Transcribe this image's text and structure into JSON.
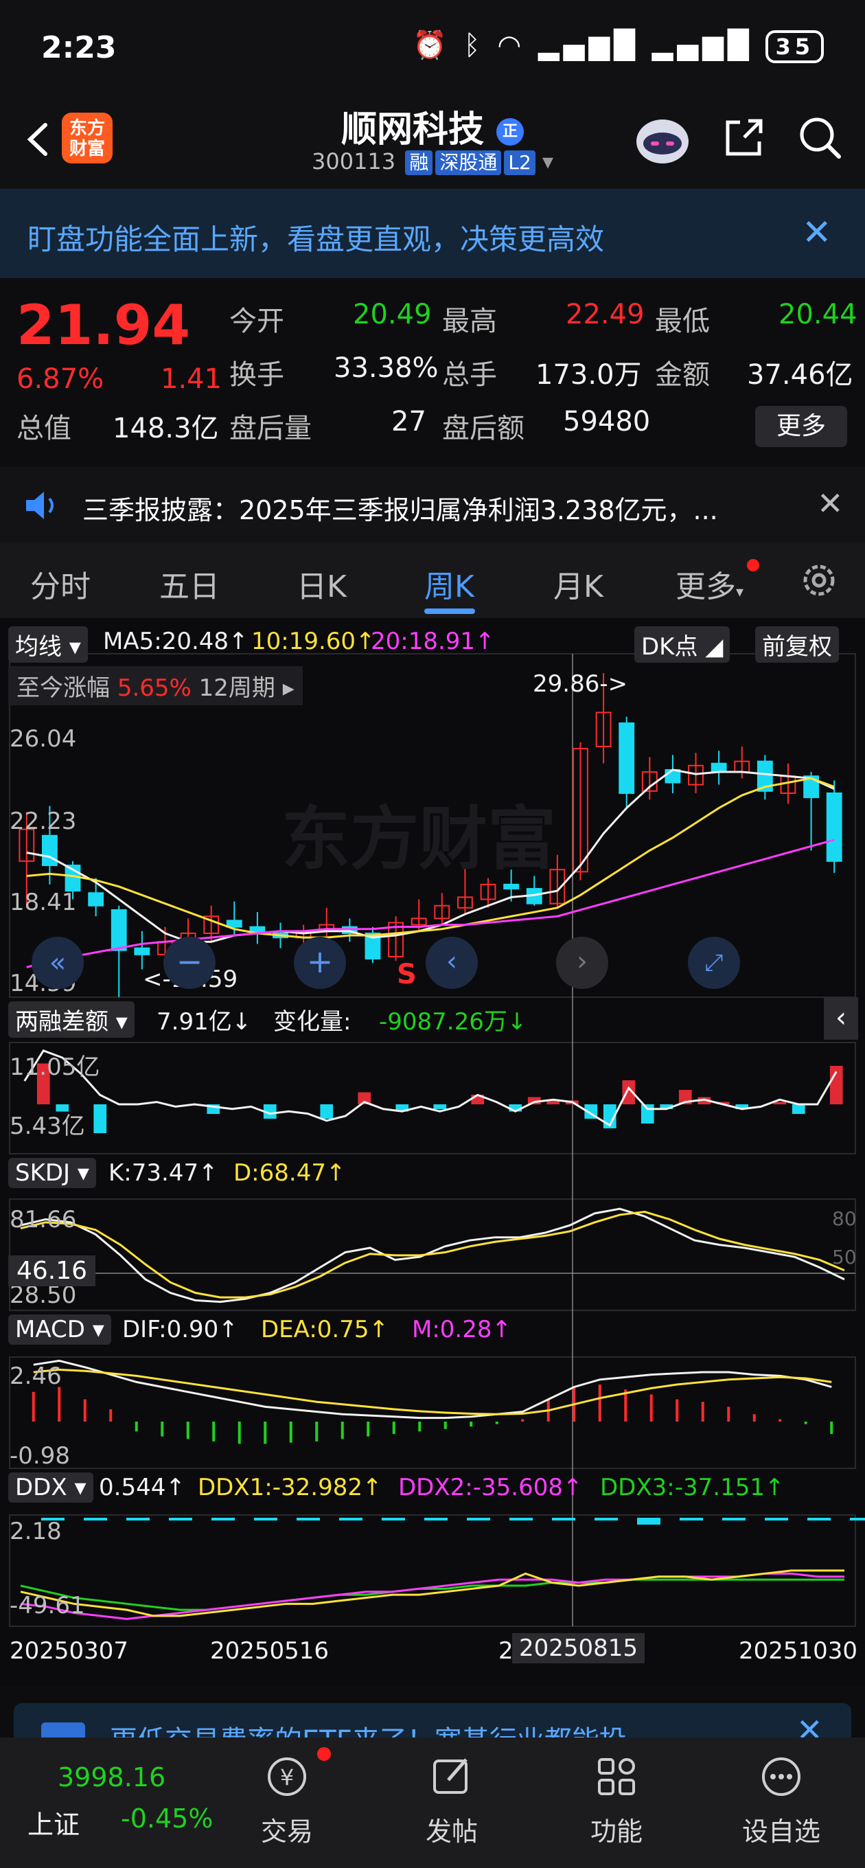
{
  "status": {
    "time": "2:23",
    "battery": "35"
  },
  "header": {
    "logo": "东方财富",
    "name": "顺网科技",
    "code": "300113",
    "tags": [
      "融",
      "深股通",
      "L2"
    ]
  },
  "banner": {
    "text": "盯盘功能全面上新，看盘更直观，决策更高效"
  },
  "quote": {
    "price": "21.94",
    "pct": "6.87%",
    "change": "1.41",
    "open_label": "今开",
    "open": "20.49",
    "high_label": "最高",
    "high": "22.49",
    "low_label": "最低",
    "low": "20.44",
    "turnover_label": "换手",
    "turnover": "33.38%",
    "volume_label": "总手",
    "volume": "173.0万",
    "amount_label": "金额",
    "amount": "37.46亿",
    "mcap_label": "总值",
    "mcap": "148.3亿",
    "after_vol_label": "盘后量",
    "after_vol": "27",
    "after_amt_label": "盘后额",
    "after_amt": "59480",
    "more": "更多"
  },
  "news": {
    "text": "三季报披露：2025年三季报归属净利润3.238亿元，..."
  },
  "tabs": [
    "分时",
    "五日",
    "日K",
    "周K",
    "月K",
    "更多"
  ],
  "indicators": {
    "ma_select": "均线",
    "ma5": "MA5:20.48↑",
    "ma10": "10:19.60↑",
    "ma20": "20:18.91↑",
    "dk": "DK点",
    "fq": "前复权",
    "range_label": "至今涨幅",
    "range_pct": "5.65%",
    "range_period": "12周期",
    "peak_label": "29.86->",
    "trough_label": "<-14.59",
    "s_mark": "S",
    "rz_select": "两融差额",
    "rz_value": "7.91亿↓",
    "rz_change_label": "变化量:",
    "rz_change": "-9087.26万↓",
    "skdj_select": "SKDJ",
    "skdj_k": "K:73.47↑",
    "skdj_d": "D:68.47↑",
    "skdj_cursor": "46.16",
    "macd_select": "MACD",
    "macd_dif": "DIF:0.90↑",
    "macd_dea": "DEA:0.75↑",
    "macd_m": "M:0.28↑",
    "ddx_select": "DDX",
    "ddx": "0.544↑",
    "ddx1": "DDX1:-32.982↑",
    "ddx2": "DDX2:-35.608↑",
    "ddx3": "DDX3:-37.151↑"
  },
  "axes": {
    "k_ticks": [
      "26.04",
      "22.23",
      "18.41",
      "14.59"
    ],
    "rz_ticks": [
      "11.05亿",
      "5.43亿"
    ],
    "skdj_ticks": [
      "81.66",
      "28.50"
    ],
    "skdj_right": [
      "80",
      "50"
    ],
    "macd_ticks": [
      "2.46",
      "-0.98"
    ],
    "ddx_ticks": [
      "2.18",
      "-49.61"
    ],
    "dates": [
      "20250307",
      "20250516",
      "2",
      "20250815",
      "20251030"
    ]
  },
  "ad": {
    "text": "更低交易费率的ETF来了！宽基行业都能投"
  },
  "nav": {
    "index_name": "上证",
    "index_value": "3998.16",
    "index_pct": "-0.45%",
    "items": [
      "交易",
      "发帖",
      "功能",
      "设自选"
    ]
  },
  "chart_data": {
    "type": "candlestick",
    "candles": [
      {
        "o": 21.0,
        "c": 22.5,
        "h": 23.3,
        "l": 18.8
      },
      {
        "o": 22.2,
        "c": 20.8,
        "h": 23.6,
        "l": 19.9
      },
      {
        "o": 20.8,
        "c": 19.6,
        "h": 21.0,
        "l": 19.2
      },
      {
        "o": 19.5,
        "c": 18.9,
        "h": 20.2,
        "l": 18.4
      },
      {
        "o": 18.7,
        "c": 16.8,
        "h": 18.9,
        "l": 14.6
      },
      {
        "o": 16.9,
        "c": 16.6,
        "h": 17.7,
        "l": 15.9
      },
      {
        "o": 16.6,
        "c": 17.2,
        "h": 17.9,
        "l": 16.1
      },
      {
        "o": 17.1,
        "c": 17.6,
        "h": 18.3,
        "l": 16.7
      },
      {
        "o": 17.6,
        "c": 18.4,
        "h": 18.9,
        "l": 17.2
      },
      {
        "o": 18.2,
        "c": 17.9,
        "h": 19.1,
        "l": 17.5
      },
      {
        "o": 17.9,
        "c": 17.6,
        "h": 18.6,
        "l": 17.1
      },
      {
        "o": 17.6,
        "c": 17.4,
        "h": 18.1,
        "l": 16.9
      },
      {
        "o": 17.4,
        "c": 17.7,
        "h": 18.0,
        "l": 17.0
      },
      {
        "o": 17.7,
        "c": 18.0,
        "h": 18.8,
        "l": 17.3
      },
      {
        "o": 17.9,
        "c": 17.6,
        "h": 18.3,
        "l": 17.2
      },
      {
        "o": 17.6,
        "c": 16.4,
        "h": 17.9,
        "l": 16.2
      },
      {
        "o": 16.5,
        "c": 18.1,
        "h": 18.4,
        "l": 16.3
      },
      {
        "o": 18.0,
        "c": 18.3,
        "h": 19.2,
        "l": 17.7
      },
      {
        "o": 18.3,
        "c": 18.9,
        "h": 19.5,
        "l": 18.0
      },
      {
        "o": 18.8,
        "c": 19.3,
        "h": 20.7,
        "l": 18.5
      },
      {
        "o": 19.2,
        "c": 19.9,
        "h": 20.2,
        "l": 18.8
      },
      {
        "o": 19.9,
        "c": 19.7,
        "h": 20.6,
        "l": 19.1
      },
      {
        "o": 19.7,
        "c": 19.0,
        "h": 20.3,
        "l": 18.9
      },
      {
        "o": 19.0,
        "c": 20.6,
        "h": 21.3,
        "l": 18.8
      },
      {
        "o": 20.5,
        "c": 26.3,
        "h": 26.6,
        "l": 20.1
      },
      {
        "o": 26.4,
        "c": 28.0,
        "h": 29.86,
        "l": 25.6
      },
      {
        "o": 27.5,
        "c": 24.2,
        "h": 27.8,
        "l": 23.5
      },
      {
        "o": 24.3,
        "c": 25.2,
        "h": 25.9,
        "l": 23.9
      },
      {
        "o": 25.3,
        "c": 24.7,
        "h": 26.0,
        "l": 24.2
      },
      {
        "o": 24.6,
        "c": 25.5,
        "h": 26.1,
        "l": 24.2
      },
      {
        "o": 25.6,
        "c": 25.2,
        "h": 26.2,
        "l": 24.6
      },
      {
        "o": 25.2,
        "c": 25.7,
        "h": 26.4,
        "l": 24.9
      },
      {
        "o": 25.7,
        "c": 24.3,
        "h": 26.0,
        "l": 23.9
      },
      {
        "o": 24.2,
        "c": 25.0,
        "h": 25.6,
        "l": 23.7
      },
      {
        "o": 25.0,
        "c": 24.0,
        "h": 25.2,
        "l": 21.5
      },
      {
        "o": 24.2,
        "c": 21.0,
        "h": 24.8,
        "l": 20.44
      }
    ],
    "ma5": [
      21.4,
      21.2,
      20.6,
      20.0,
      19.2,
      18.4,
      17.6,
      17.2,
      17.2,
      17.5,
      17.6,
      17.7,
      17.6,
      17.7,
      17.7,
      17.4,
      17.5,
      17.7,
      18.0,
      18.5,
      18.9,
      19.3,
      19.4,
      19.6,
      20.8,
      22.3,
      23.5,
      24.5,
      25.3,
      25.1,
      25.2,
      25.2,
      25.1,
      25.0,
      24.9,
      24.4
    ],
    "ma10": [
      20.3,
      20.4,
      20.3,
      20.1,
      19.8,
      19.4,
      19.0,
      18.6,
      18.2,
      17.8,
      17.6,
      17.5,
      17.4,
      17.4,
      17.5,
      17.5,
      17.6,
      17.7,
      17.8,
      18.0,
      18.2,
      18.4,
      18.6,
      18.8,
      19.4,
      20.1,
      20.8,
      21.5,
      22.1,
      22.8,
      23.5,
      24.1,
      24.5,
      24.7,
      24.9,
      24.5
    ],
    "ma20": [
      16.0,
      16.3,
      16.5,
      16.7,
      16.9,
      17.1,
      17.2,
      17.3,
      17.4,
      17.5,
      17.6,
      17.7,
      17.7,
      17.8,
      17.8,
      17.8,
      17.9,
      17.9,
      18.0,
      18.0,
      18.1,
      18.2,
      18.3,
      18.4,
      18.7,
      19.0,
      19.3,
      19.6,
      19.9,
      20.2,
      20.5,
      20.8,
      21.1,
      21.4,
      21.7,
      22.0
    ],
    "k_range": [
      14.59,
      29.86
    ],
    "rz_bars": [
      0,
      8.5,
      -1.5,
      0,
      -6,
      0,
      0,
      0,
      0,
      0,
      -2,
      0,
      0,
      -3,
      0,
      0,
      -3,
      0,
      2.5,
      0,
      -1.5,
      0,
      -1,
      0,
      2,
      0,
      -1.5,
      1.5,
      1,
      0.8,
      -3,
      -5,
      5,
      -4,
      -1,
      3,
      1.5,
      0.5,
      -1,
      0,
      0.5,
      -2,
      0,
      8
    ],
    "rz_line": [
      9.5,
      10.8,
      10.5,
      9.8,
      8.9,
      8.5,
      8.5,
      8.6,
      8.4,
      8.5,
      8.4,
      8.3,
      8.4,
      8.1,
      8.2,
      8.1,
      7.8,
      8.0,
      8.6,
      8.3,
      8.2,
      8.4,
      8.2,
      8.4,
      8.9,
      8.6,
      8.2,
      8.6,
      8.7,
      8.6,
      8.1,
      7.6,
      9.2,
      8.3,
      8.3,
      8.6,
      8.7,
      8.5,
      8.3,
      8.4,
      8.7,
      8.5,
      8.5,
      9.9
    ],
    "skdj_k": [
      78,
      82,
      80,
      72,
      58,
      42,
      33,
      28,
      27,
      29,
      33,
      40,
      50,
      60,
      63,
      55,
      57,
      64,
      68,
      70,
      70,
      73,
      78,
      86,
      89,
      84,
      76,
      68,
      65,
      63,
      60,
      57,
      50,
      42
    ],
    "skdj_d": [
      76,
      80,
      79,
      75,
      65,
      52,
      40,
      33,
      30,
      30,
      32,
      37,
      44,
      53,
      59,
      58,
      58,
      60,
      64,
      67,
      69,
      71,
      74,
      80,
      85,
      87,
      82,
      75,
      69,
      65,
      62,
      59,
      55,
      48
    ],
    "macd_dif": [
      2.3,
      2.46,
      2.2,
      1.9,
      1.6,
      1.4,
      1.2,
      1.0,
      0.8,
      0.6,
      0.5,
      0.4,
      0.3,
      0.25,
      0.2,
      0.15,
      0.15,
      0.2,
      0.3,
      0.4,
      0.9,
      1.4,
      1.7,
      1.8,
      1.9,
      1.95,
      2.0,
      2.0,
      1.9,
      1.85,
      1.7,
      1.4
    ],
    "macd_dea": [
      2.0,
      2.1,
      2.05,
      1.95,
      1.85,
      1.7,
      1.55,
      1.4,
      1.25,
      1.1,
      0.95,
      0.8,
      0.7,
      0.6,
      0.5,
      0.42,
      0.36,
      0.32,
      0.3,
      0.32,
      0.45,
      0.7,
      0.95,
      1.15,
      1.35,
      1.5,
      1.6,
      1.7,
      1.75,
      1.8,
      1.75,
      1.6
    ],
    "macd_bars": [
      1.2,
      1.4,
      0.9,
      0.5,
      -0.4,
      -0.6,
      -0.7,
      -0.8,
      -0.9,
      -0.9,
      -0.85,
      -0.8,
      -0.7,
      -0.6,
      -0.5,
      -0.4,
      -0.3,
      -0.2,
      -0.1,
      0.1,
      0.9,
      1.4,
      1.5,
      1.3,
      1.1,
      0.9,
      0.8,
      0.6,
      0.3,
      0.1,
      -0.1,
      -0.5
    ],
    "ddx_y": [
      -40,
      -42,
      -44,
      -45,
      -46,
      -48,
      -48,
      -47,
      -46,
      -45,
      -44,
      -44,
      -43,
      -42,
      -41,
      -41,
      -40,
      -39,
      -38,
      -34,
      -37,
      -38,
      -37,
      -36,
      -35,
      -35,
      -36,
      -35,
      -34,
      -33,
      -33,
      -33
    ],
    "ddx_m": [
      -44,
      -45,
      -47,
      -48,
      -49,
      -48,
      -47,
      -46,
      -45,
      -44,
      -43,
      -42,
      -41,
      -40,
      -40,
      -39,
      -38,
      -37,
      -36,
      -36,
      -36,
      -37,
      -36,
      -36,
      -35,
      -35,
      -35,
      -35,
      -34,
      -34,
      -35,
      -35
    ],
    "ddx_g": [
      -38,
      -40,
      -42,
      -43,
      -44,
      -45,
      -46,
      -46,
      -45,
      -44,
      -43,
      -42,
      -41,
      -41,
      -40,
      -39,
      -39,
      -38,
      -38,
      -38,
      -37,
      -37,
      -37,
      -36,
      -36,
      -36,
      -36,
      -36,
      -36,
      -36,
      -36,
      -36
    ]
  }
}
